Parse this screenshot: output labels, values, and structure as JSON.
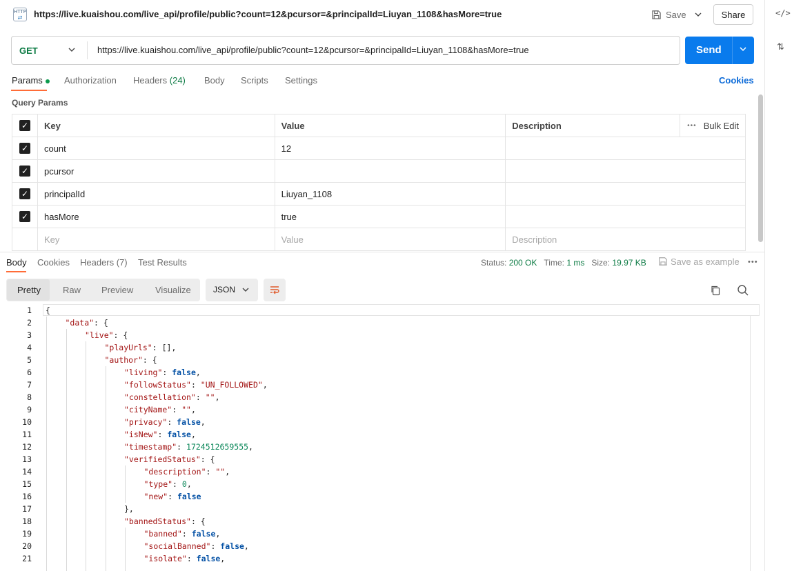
{
  "header": {
    "title_url": "https://live.kuaishou.com/live_api/profile/public?count=12&pcursor=&principalId=Liuyan_1108&hasMore=true",
    "save_label": "Save",
    "share_label": "Share",
    "http_icon_text": "HTTP"
  },
  "request": {
    "method": "GET",
    "url": "https://live.kuaishou.com/live_api/profile/public?count=12&pcursor=&principalId=Liuyan_1108&hasMore=true",
    "send_label": "Send"
  },
  "request_tabs": {
    "params": "Params",
    "authorization": "Authorization",
    "headers": "Headers",
    "headers_count": "(24)",
    "body": "Body",
    "scripts": "Scripts",
    "settings": "Settings",
    "cookies": "Cookies"
  },
  "query_params": {
    "section_label": "Query Params",
    "columns": {
      "key": "Key",
      "value": "Value",
      "description": "Description",
      "bulk_edit": "Bulk Edit"
    },
    "rows": [
      {
        "key": "count",
        "value": "12",
        "description": "",
        "checked": true
      },
      {
        "key": "pcursor",
        "value": "",
        "description": "",
        "checked": true
      },
      {
        "key": "principalId",
        "value": "Liuyan_1108",
        "description": "",
        "checked": true
      },
      {
        "key": "hasMore",
        "value": "true",
        "description": "",
        "checked": true
      }
    ],
    "placeholders": {
      "key": "Key",
      "value": "Value",
      "description": "Description"
    }
  },
  "response_tabs": {
    "body": "Body",
    "cookies": "Cookies",
    "headers": "Headers (7)",
    "test_results": "Test Results"
  },
  "response_status": {
    "status_label": "Status:",
    "status_value": "200 OK",
    "time_label": "Time:",
    "time_value": "1 ms",
    "size_label": "Size:",
    "size_value": "19.97 KB",
    "save_example": "Save as example"
  },
  "view_modes": [
    "Pretty",
    "Raw",
    "Preview",
    "Visualize"
  ],
  "format_select": "JSON",
  "code_lines": [
    {
      "n": "1",
      "indent": 0,
      "t": [
        [
          "p",
          "{"
        ]
      ]
    },
    {
      "n": "2",
      "indent": 1,
      "t": [
        [
          "k",
          "\"data\""
        ],
        [
          "p",
          ": {"
        ]
      ]
    },
    {
      "n": "3",
      "indent": 2,
      "t": [
        [
          "k",
          "\"live\""
        ],
        [
          "p",
          ": {"
        ]
      ]
    },
    {
      "n": "4",
      "indent": 3,
      "t": [
        [
          "k",
          "\"playUrls\""
        ],
        [
          "p",
          ": [],"
        ]
      ]
    },
    {
      "n": "5",
      "indent": 3,
      "t": [
        [
          "k",
          "\"author\""
        ],
        [
          "p",
          ": {"
        ]
      ]
    },
    {
      "n": "6",
      "indent": 4,
      "t": [
        [
          "k",
          "\"living\""
        ],
        [
          "p",
          ": "
        ],
        [
          "b",
          "false"
        ],
        [
          "p",
          ","
        ]
      ]
    },
    {
      "n": "7",
      "indent": 4,
      "t": [
        [
          "k",
          "\"followStatus\""
        ],
        [
          "p",
          ": "
        ],
        [
          "s",
          "\"UN_FOLLOWED\""
        ],
        [
          "p",
          ","
        ]
      ]
    },
    {
      "n": "8",
      "indent": 4,
      "t": [
        [
          "k",
          "\"constellation\""
        ],
        [
          "p",
          ": "
        ],
        [
          "s",
          "\"\""
        ],
        [
          "p",
          ","
        ]
      ]
    },
    {
      "n": "9",
      "indent": 4,
      "t": [
        [
          "k",
          "\"cityName\""
        ],
        [
          "p",
          ": "
        ],
        [
          "s",
          "\"\""
        ],
        [
          "p",
          ","
        ]
      ]
    },
    {
      "n": "10",
      "indent": 4,
      "t": [
        [
          "k",
          "\"privacy\""
        ],
        [
          "p",
          ": "
        ],
        [
          "b",
          "false"
        ],
        [
          "p",
          ","
        ]
      ]
    },
    {
      "n": "11",
      "indent": 4,
      "t": [
        [
          "k",
          "\"isNew\""
        ],
        [
          "p",
          ": "
        ],
        [
          "b",
          "false"
        ],
        [
          "p",
          ","
        ]
      ]
    },
    {
      "n": "12",
      "indent": 4,
      "t": [
        [
          "k",
          "\"timestamp\""
        ],
        [
          "p",
          ": "
        ],
        [
          "n",
          "1724512659555"
        ],
        [
          "p",
          ","
        ]
      ]
    },
    {
      "n": "13",
      "indent": 4,
      "t": [
        [
          "k",
          "\"verifiedStatus\""
        ],
        [
          "p",
          ": {"
        ]
      ]
    },
    {
      "n": "14",
      "indent": 5,
      "t": [
        [
          "k",
          "\"description\""
        ],
        [
          "p",
          ": "
        ],
        [
          "s",
          "\"\""
        ],
        [
          "p",
          ","
        ]
      ]
    },
    {
      "n": "15",
      "indent": 5,
      "t": [
        [
          "k",
          "\"type\""
        ],
        [
          "p",
          ": "
        ],
        [
          "n",
          "0"
        ],
        [
          "p",
          ","
        ]
      ]
    },
    {
      "n": "16",
      "indent": 5,
      "t": [
        [
          "k",
          "\"new\""
        ],
        [
          "p",
          ": "
        ],
        [
          "b",
          "false"
        ]
      ]
    },
    {
      "n": "17",
      "indent": 4,
      "t": [
        [
          "p",
          "},"
        ]
      ]
    },
    {
      "n": "18",
      "indent": 4,
      "t": [
        [
          "k",
          "\"bannedStatus\""
        ],
        [
          "p",
          ": {"
        ]
      ]
    },
    {
      "n": "19",
      "indent": 5,
      "t": [
        [
          "k",
          "\"banned\""
        ],
        [
          "p",
          ": "
        ],
        [
          "b",
          "false"
        ],
        [
          "p",
          ","
        ]
      ]
    },
    {
      "n": "20",
      "indent": 5,
      "t": [
        [
          "k",
          "\"socialBanned\""
        ],
        [
          "p",
          ": "
        ],
        [
          "b",
          "false"
        ],
        [
          "p",
          ","
        ]
      ]
    },
    {
      "n": "21",
      "indent": 5,
      "t": [
        [
          "k",
          "\"isolate\""
        ],
        [
          "p",
          ": "
        ],
        [
          "b",
          "false"
        ],
        [
          "p",
          ","
        ]
      ]
    }
  ]
}
